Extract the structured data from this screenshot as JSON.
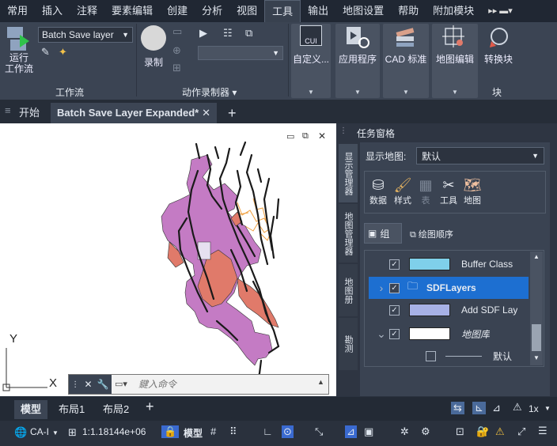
{
  "menubar": {
    "items": [
      "常用",
      "插入",
      "注释",
      "要素编辑",
      "创建",
      "分析",
      "视图",
      "工具",
      "输出",
      "地图设置",
      "帮助",
      "附加模块"
    ],
    "active_index": 7,
    "overflow": "▸▸ ▬▾"
  },
  "ribbon": {
    "run_workflow_label": "运行\n工作流",
    "workflow_select_value": "Batch Save layer",
    "workflow_group_label": "工作流",
    "record_label": "录制",
    "action_recorder_group_label": "动作录制器 ▾",
    "cui_badge": "CUI",
    "custom_label": "自定义...",
    "apps_label": "应用程序",
    "cad_standards_label": "CAD 标准",
    "map_edit_label": "地图编辑",
    "convert_block_label": "转换块",
    "block_group_label": "块"
  },
  "doc_tabs": {
    "start_label": "开始",
    "active_label": "Batch Save Layer Expanded*",
    "close_glyph": "✕",
    "new_tab_glyph": "+"
  },
  "command_line": {
    "placeholder": "鍵入命令"
  },
  "ucs": {
    "y_label": "Y",
    "x_label": "X"
  },
  "task_pane": {
    "title": "任务窗格",
    "vertical_tabs": [
      "显示管理器",
      "地图管理器",
      "地图册",
      "勘测"
    ],
    "show_map_label": "显示地图:",
    "show_map_value": "默认",
    "toolbar_items": [
      "数据",
      "样式",
      "表",
      "工具",
      "地图"
    ],
    "group_label": "组",
    "draw_order_label": "绘图顺序",
    "layers": [
      {
        "name": "Buffer Class",
        "checked": true,
        "swatch": "#7fd0ea",
        "selected": false,
        "expander": ""
      },
      {
        "name": "SDFLayers",
        "checked": true,
        "swatch": "folder",
        "selected": true,
        "expander": "›"
      },
      {
        "name": "Add SDF Lay",
        "checked": true,
        "swatch": "#a7b1e6",
        "selected": false,
        "expander": ""
      },
      {
        "name": "地图库",
        "checked": true,
        "swatch": "#ffffff",
        "selected": false,
        "expander": "⌄"
      },
      {
        "name": "默认",
        "checked": false,
        "swatch": "line",
        "selected": false,
        "expander": ""
      }
    ]
  },
  "layout_tabs": {
    "items": [
      "模型",
      "布局1",
      "布局2"
    ],
    "active_index": 0,
    "add_glyph": "+"
  },
  "status": {
    "coord_system": "CA-I",
    "scale": "1:1.18144e+06",
    "model_label": "模型",
    "annot_scale": "1x"
  },
  "colors": {
    "menubar_bg": "#202733",
    "ribbon_bg": "#3b4453",
    "canvas_bg": "#ffffff",
    "selection_blue": "#1d6fd1",
    "map_purple": "#c47bc4",
    "map_salmon": "#e07a6a",
    "map_orange": "#f0a040"
  }
}
